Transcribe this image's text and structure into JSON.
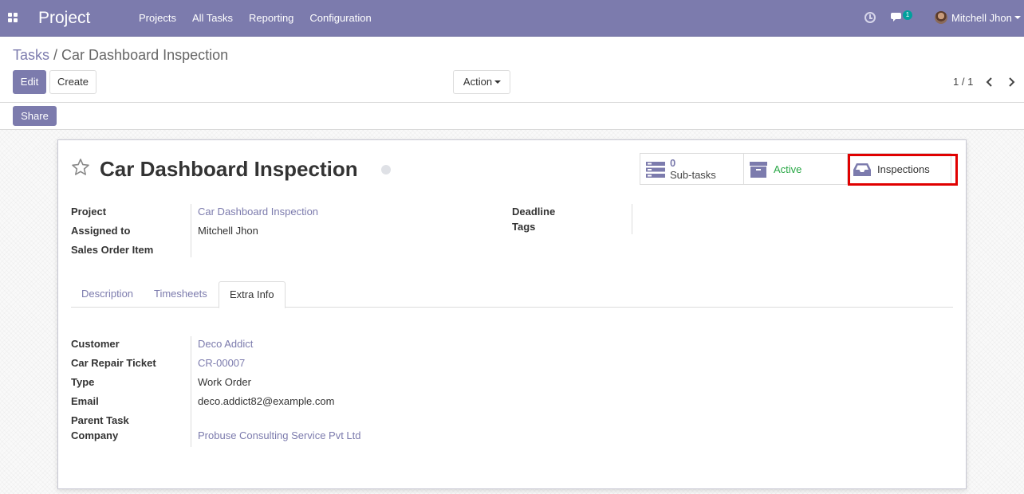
{
  "navbar": {
    "app_title": "Project",
    "menu": [
      "Projects",
      "All Tasks",
      "Reporting",
      "Configuration"
    ],
    "chat_count": "1",
    "user_name": "Mitchell Jhon",
    "color": "#7c7bad"
  },
  "breadcrumb": {
    "parent": "Tasks",
    "separator": "/",
    "current": "Car Dashboard Inspection"
  },
  "toolbar": {
    "edit_label": "Edit",
    "create_label": "Create",
    "action_label": "Action",
    "share_label": "Share",
    "pager": "1 / 1"
  },
  "record": {
    "title": "Car Dashboard Inspection",
    "smart_buttons": {
      "subtasks_value": "0",
      "subtasks_label": "Sub-tasks",
      "active_label": "Active",
      "inspections_label": "Inspections"
    },
    "fields": {
      "project_label": "Project",
      "project_value": "Car Dashboard Inspection",
      "assigned_label": "Assigned to",
      "assigned_value": "Mitchell Jhon",
      "sales_order_label": "Sales Order Item",
      "deadline_label": "Deadline",
      "tags_label": "Tags"
    },
    "tabs": [
      "Description",
      "Timesheets",
      "Extra Info"
    ],
    "active_tab": "Extra Info",
    "extra_info": {
      "customer_label": "Customer",
      "customer_value": "Deco Addict",
      "ticket_label": "Car Repair Ticket",
      "ticket_value": "CR-00007",
      "type_label": "Type",
      "type_value": "Work Order",
      "email_label": "Email",
      "email_value": "deco.addict82@example.com",
      "parent_label": "Parent Task",
      "company_label": "Company",
      "company_value": "Probuse Consulting Service Pvt Ltd"
    }
  },
  "icons": [
    "apps-icon",
    "clock-icon",
    "chat-icon",
    "avatar",
    "chevron-left-icon",
    "chevron-right-icon",
    "star-icon",
    "tasks-icon",
    "archive-icon",
    "inbox-icon"
  ]
}
